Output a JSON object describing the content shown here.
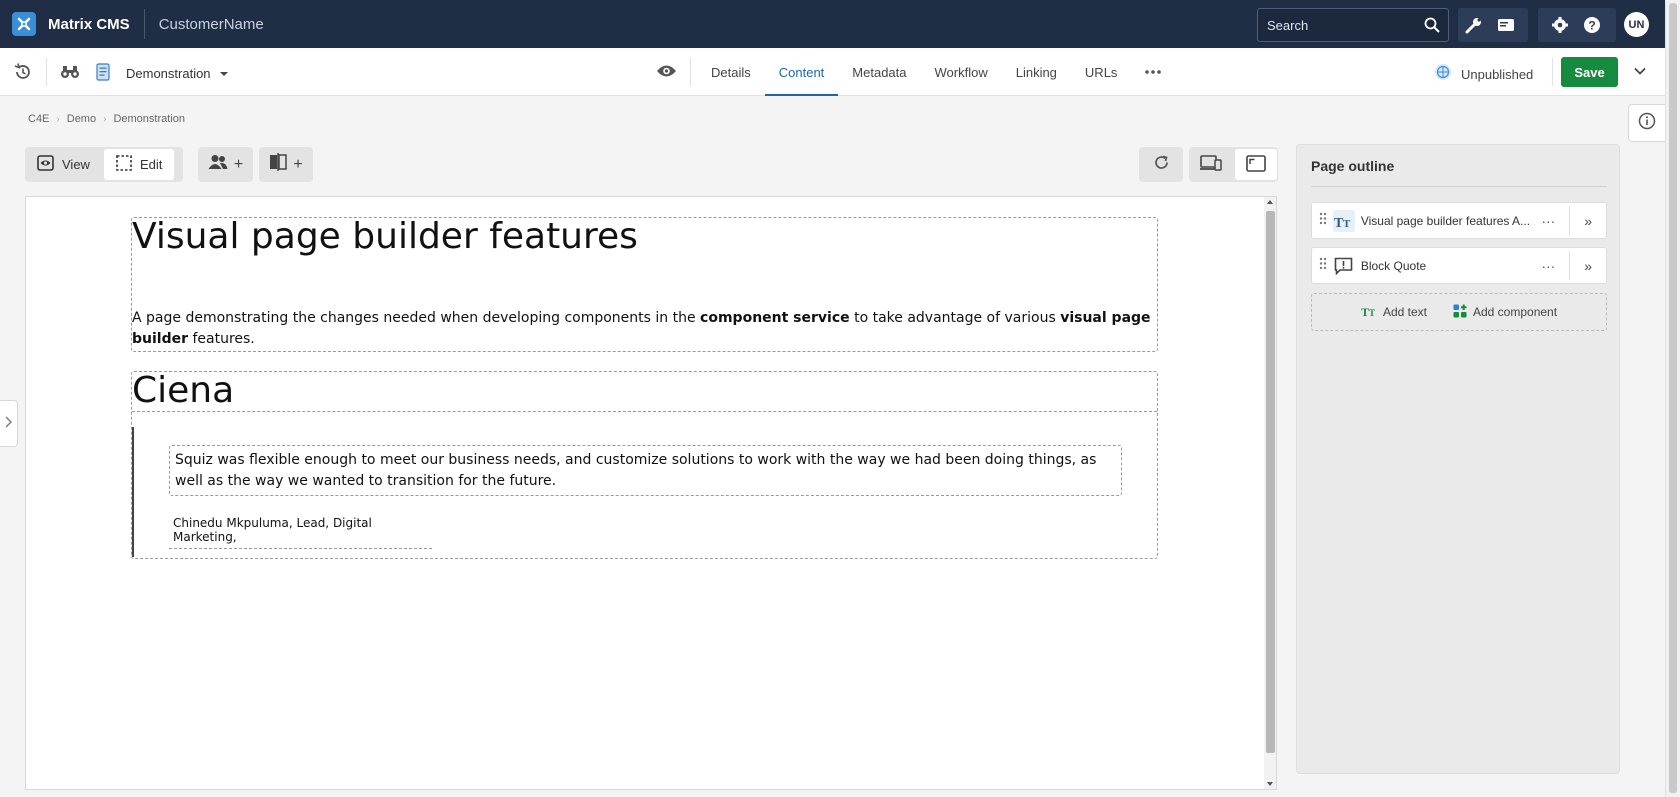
{
  "topbar": {
    "app_name": "Matrix CMS",
    "customer": "CustomerName",
    "search_placeholder": "Search",
    "avatar": "UN",
    "bg_color": "#1f2d45"
  },
  "subbar": {
    "asset_name": "Demonstration",
    "tabs": [
      "Details",
      "Content",
      "Metadata",
      "Workflow",
      "Linking",
      "URLs"
    ],
    "active_tab": "Content",
    "status": "Unpublished",
    "save_label": "Save",
    "save_color": "#168a3e"
  },
  "breadcrumb": [
    "C4E",
    "Demo",
    "Demonstration"
  ],
  "toolbar": {
    "view_label": "View",
    "edit_label": "Edit",
    "plus": "+"
  },
  "canvas": {
    "heading1": "Visual page builder features",
    "paragraph": {
      "part1": "A page demonstrating the changes needed when developing components in the ",
      "bold1": "component service",
      "part2": " to take advantage of various ",
      "bold2": "visual page builder",
      "part3": " features."
    },
    "heading2": "Ciena",
    "quote": "Squiz was flexible enough to meet our business needs, and customize solutions to work with the way we had been doing things, as well as the way we wanted to transition for the future.",
    "citation": "Chinedu Mkpuluma, Lead, Digital Marketing,"
  },
  "outline": {
    "title": "Page outline",
    "items": [
      {
        "label": "Visual page builder features A...",
        "icon": "text-icon"
      },
      {
        "label": "Block Quote",
        "icon": "quote-icon"
      }
    ],
    "add_text": "Add text",
    "add_component": "Add component"
  }
}
